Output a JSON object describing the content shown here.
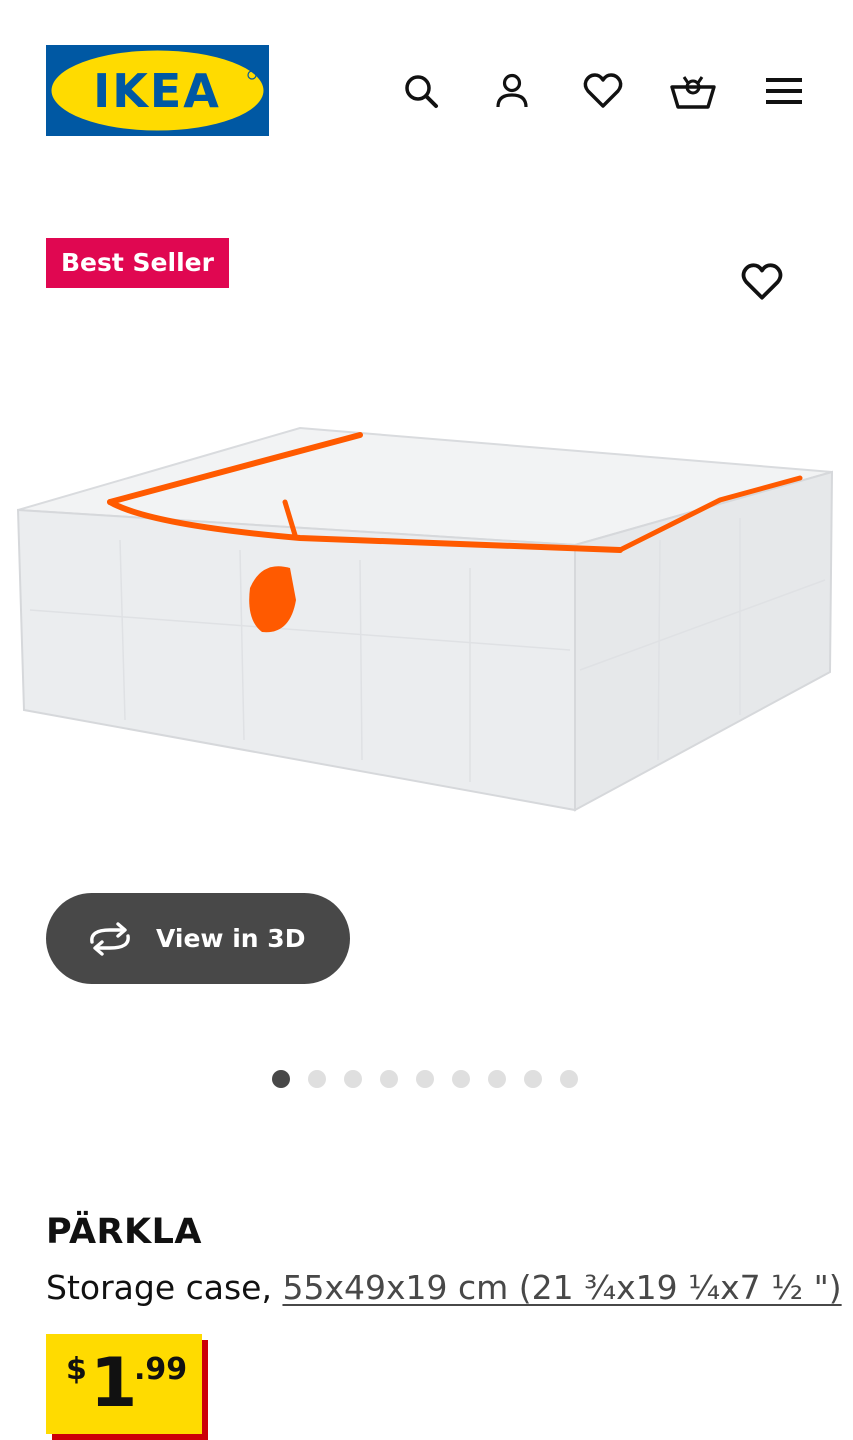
{
  "header": {
    "logo_text": "IKEA",
    "icons": [
      "search-icon",
      "account-icon",
      "heart-icon",
      "cart-icon",
      "menu-icon"
    ]
  },
  "badge": {
    "label": "Best Seller",
    "color": "#e00751"
  },
  "viewer": {
    "label": "View in 3D"
  },
  "gallery": {
    "dot_count": 9,
    "active_index": 0
  },
  "product": {
    "name": "PÄRKLA",
    "type_prefix": "Storage case, ",
    "dimensions": "55x49x19 cm (21 ¾x19 ¼x7 ½ \")",
    "price": {
      "currency": "$",
      "integer": "1",
      "decimal": ".99"
    }
  },
  "colors": {
    "brand_blue": "#0058a3",
    "brand_yellow": "#ffdb00",
    "price_red": "#cc0008",
    "accent_orange": "#ff5a00"
  }
}
